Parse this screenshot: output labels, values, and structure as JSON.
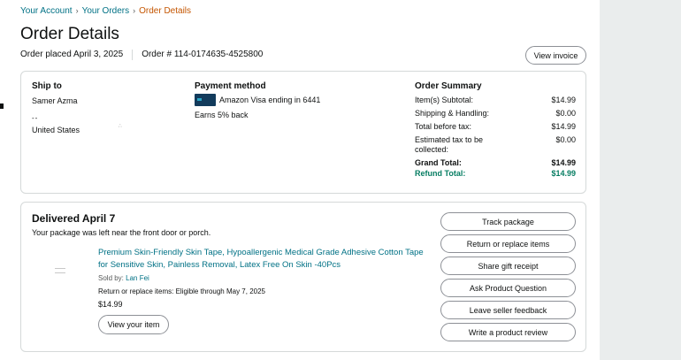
{
  "breadcrumb": {
    "items": [
      "Your Account",
      "Your Orders"
    ],
    "current": "Order Details"
  },
  "page_title": "Order Details",
  "order_meta": {
    "placed": "Order placed April 3, 2025",
    "number": "Order # 114-0174635-4525800"
  },
  "view_invoice_label": "View invoice",
  "ship_to": {
    "heading": "Ship to",
    "name": "Samer Azma",
    "line": "--",
    "country": "United States"
  },
  "payment": {
    "heading": "Payment method",
    "card": "Amazon Visa ending in 6441",
    "rewards": "Earns 5% back",
    "card_icon": "card-icon"
  },
  "summary": {
    "heading": "Order Summary",
    "rows": [
      {
        "label": "Item(s) Subtotal:",
        "value": "$14.99"
      },
      {
        "label": "Shipping & Handling:",
        "value": "$0.00"
      },
      {
        "label": "Total before tax:",
        "value": "$14.99"
      },
      {
        "label": "Estimated tax to be collected:",
        "value": "$0.00"
      }
    ],
    "grand_total": {
      "label": "Grand Total:",
      "value": "$14.99"
    },
    "refund_total": {
      "label": "Refund Total:",
      "value": "$14.99"
    }
  },
  "delivery": {
    "status": "Delivered April 7",
    "note": "Your package was left near the front door or porch.",
    "item": {
      "title": "Premium Skin-Friendly Skin Tape, Hypoallergenic Medical Grade Adhesive Cotton Tape for Sensitive Skin, Painless Removal, Latex Free On Skin -40Pcs",
      "sold_by_label": "Sold by:",
      "seller": "Lan Fei",
      "return_window": "Return or replace items: Eligible through May 7, 2025",
      "price": "$14.99",
      "view_label": "View your item"
    },
    "actions": [
      "Track package",
      "Return or replace items",
      "Share gift receipt",
      "Ask Product Question",
      "Leave seller feedback",
      "Write a product review"
    ]
  },
  "colors": {
    "link": "#007185",
    "breadcrumb_current": "#c45500",
    "refund": "#067d62",
    "border": "#d5d9d9"
  }
}
